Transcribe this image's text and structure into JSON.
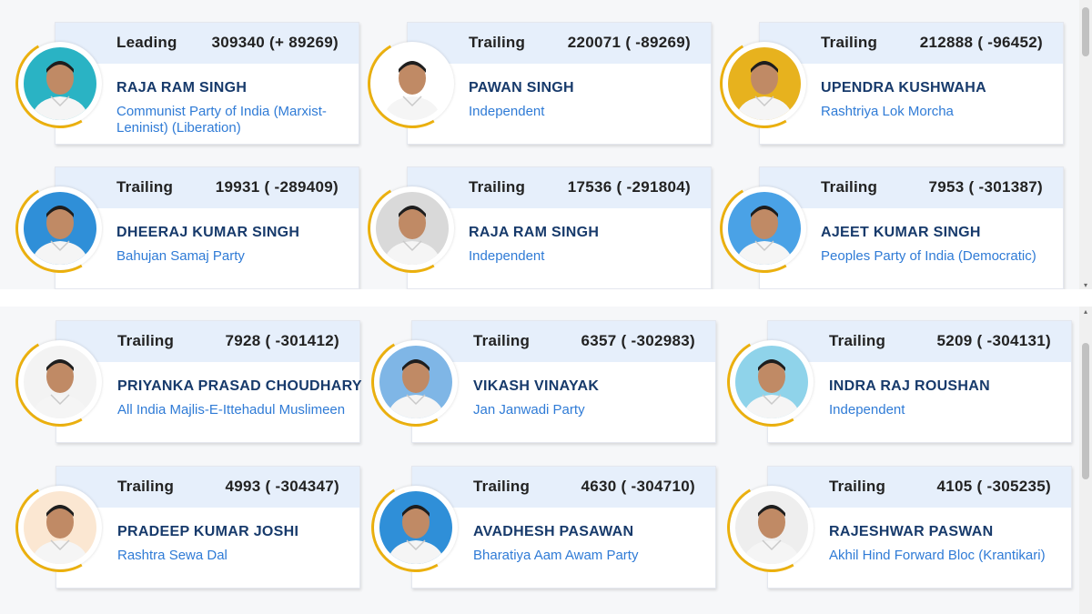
{
  "panels": [
    {
      "cards": [
        {
          "status": "Leading",
          "votes": "309340 (+ 89269)",
          "name": "RAJA RAM SINGH",
          "party": "Communist Party of India (Marxist-Leninist) (Liberation)",
          "photo_bg": "#2ab3c4"
        },
        {
          "status": "Trailing",
          "votes": "220071 ( -89269)",
          "name": "PAWAN SINGH",
          "party": "Independent",
          "photo_bg": "#ffffff"
        },
        {
          "status": "Trailing",
          "votes": "212888 ( -96452)",
          "name": "UPENDRA KUSHWAHA",
          "party": "Rashtriya Lok Morcha",
          "photo_bg": "#e7b21e"
        },
        {
          "status": "Trailing",
          "votes": "19931 ( -289409)",
          "name": "DHEERAJ KUMAR SINGH",
          "party": "Bahujan Samaj Party",
          "photo_bg": "#2f8fd8"
        },
        {
          "status": "Trailing",
          "votes": "17536 ( -291804)",
          "name": "RAJA RAM SINGH",
          "party": "Independent",
          "photo_bg": "#d9d9d9"
        },
        {
          "status": "Trailing",
          "votes": "7953 ( -301387)",
          "name": "AJEET KUMAR SINGH",
          "party": "Peoples Party of India (Democratic)",
          "photo_bg": "#4aa2e6"
        }
      ]
    },
    {
      "cards": [
        {
          "status": "Trailing",
          "votes": "7928 ( -301412)",
          "name": "PRIYANKA PRASAD CHOUDHARY",
          "party": "All India Majlis-E-Ittehadul Muslimeen",
          "photo_bg": "#f3f3f3"
        },
        {
          "status": "Trailing",
          "votes": "6357 ( -302983)",
          "name": "VIKASH VINAYAK",
          "party": "Jan Janwadi Party",
          "photo_bg": "#7fb6e6"
        },
        {
          "status": "Trailing",
          "votes": "5209 ( -304131)",
          "name": "INDRA RAJ ROUSHAN",
          "party": "Independent",
          "photo_bg": "#8fd3ea"
        },
        {
          "status": "Trailing",
          "votes": "4993 ( -304347)",
          "name": "PRADEEP KUMAR JOSHI",
          "party": "Rashtra Sewa Dal",
          "photo_bg": "#fbe7d2"
        },
        {
          "status": "Trailing",
          "votes": "4630 ( -304710)",
          "name": "AVADHESH PASAWAN",
          "party": "Bharatiya Aam Awam Party",
          "photo_bg": "#2f8fd8"
        },
        {
          "status": "Trailing",
          "votes": "4105 ( -305235)",
          "name": "RAJESHWAR PASWAN",
          "party": "Akhil Hind Forward Bloc (Krantikari)",
          "photo_bg": "#eeeeee"
        }
      ]
    }
  ]
}
